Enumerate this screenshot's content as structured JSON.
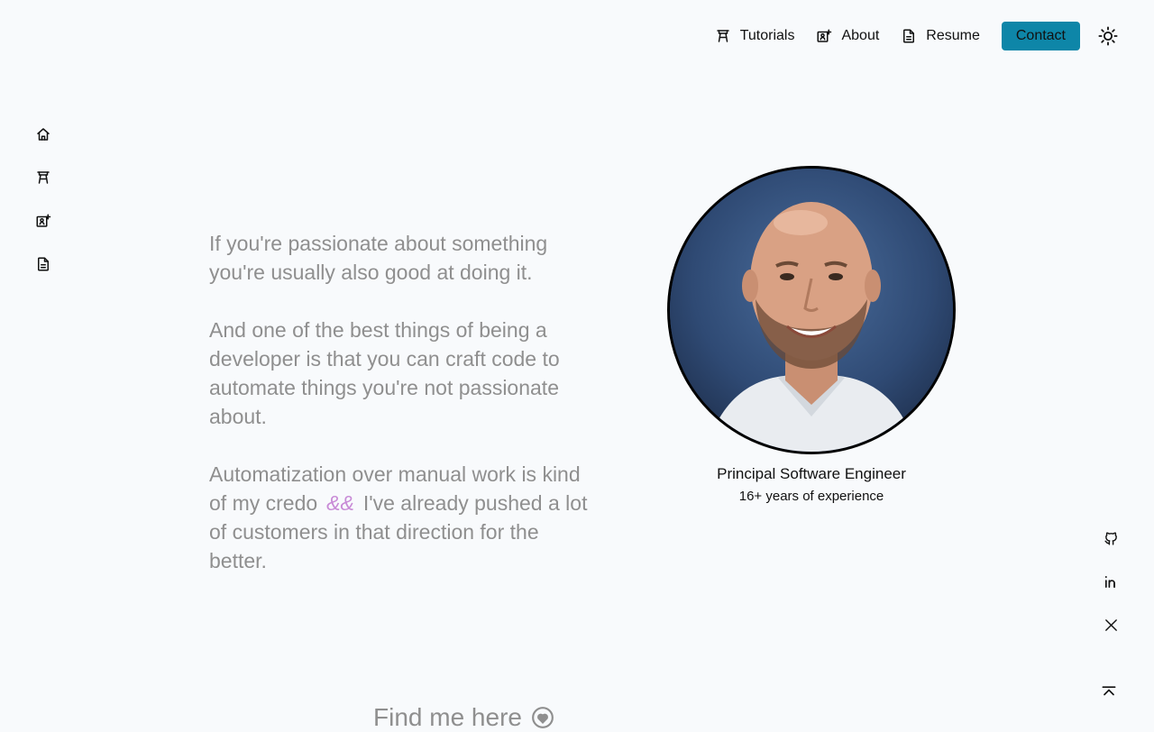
{
  "nav": {
    "tutorials": "Tutorials",
    "about": "About",
    "resume": "Resume",
    "contact": "Contact"
  },
  "intro": {
    "p1": "If you're passionate about something you're usually also good at doing it.",
    "p2": "And one of the best things of being a developer is that you can craft code to automate things you're not passionate about.",
    "p3a": "Automatization over manual work is kind of my credo",
    "p3amp": "&&",
    "p3b": "I've already pushed a lot of customers in that direction for the better."
  },
  "profile": {
    "title": "Principal Software Engineer",
    "experience": "16+ years of experience"
  },
  "footer": {
    "find_me": "Find me here"
  },
  "colors": {
    "accent": "#0e86a8",
    "background": "#f8fafc",
    "muted_text": "#8f8f8f",
    "amp_highlight": "#c88ad6"
  },
  "icons": [
    "home-icon",
    "tutorials-icon",
    "about-icon",
    "resume-icon",
    "sun-icon",
    "github-icon",
    "linkedin-icon",
    "x-icon",
    "scroll-top-icon",
    "heart-icon"
  ]
}
